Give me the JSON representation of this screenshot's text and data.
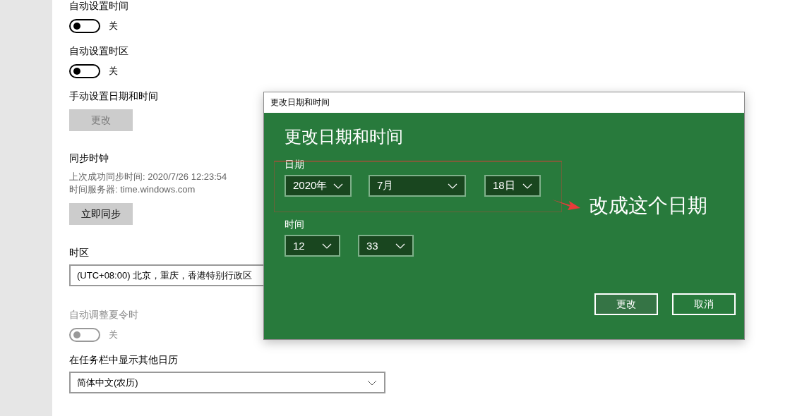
{
  "settings": {
    "items": [
      {
        "kind": "toggle",
        "label": "自动设置时间",
        "on": false,
        "disabled": false,
        "state_text": "关"
      },
      {
        "kind": "toggle",
        "label": "自动设置时区",
        "on": false,
        "disabled": false,
        "state_text": "关"
      },
      {
        "kind": "button",
        "label": "手动设置日期和时间",
        "button": "更改",
        "disabled": true
      },
      {
        "kind": "info",
        "label": "同步时钟",
        "lines": [
          "上次成功同步时间: 2020/7/26 12:23:54",
          "时间服务器: time.windows.com"
        ],
        "button": "立即同步",
        "disabled": false
      },
      {
        "kind": "hidden-end-select",
        "label": "时区",
        "value": "(UTC+08:00) 北京，重庆，香港特别行政区"
      },
      {
        "kind": "toggle",
        "label": "自动调整夏令时",
        "on": false,
        "disabled": true,
        "state_text": "关"
      },
      {
        "kind": "select",
        "label": "在任务栏中显示其他日历",
        "value": "简体中文(农历)"
      }
    ]
  },
  "dialog": {
    "title": "更改日期和时间",
    "heading": "更改日期和时间",
    "date": {
      "label": "日期",
      "fields": [
        {
          "value": "2020年"
        },
        {
          "value": "7月"
        },
        {
          "value": "18日"
        }
      ]
    },
    "time": {
      "label": "时间",
      "fields": [
        {
          "value": "12"
        },
        {
          "value": "33"
        }
      ]
    },
    "buttons": [
      {
        "label": "更改",
        "selected": true
      },
      {
        "label": "取消",
        "selected": false
      }
    ]
  },
  "annotation": {
    "text": "改成这个日期"
  }
}
